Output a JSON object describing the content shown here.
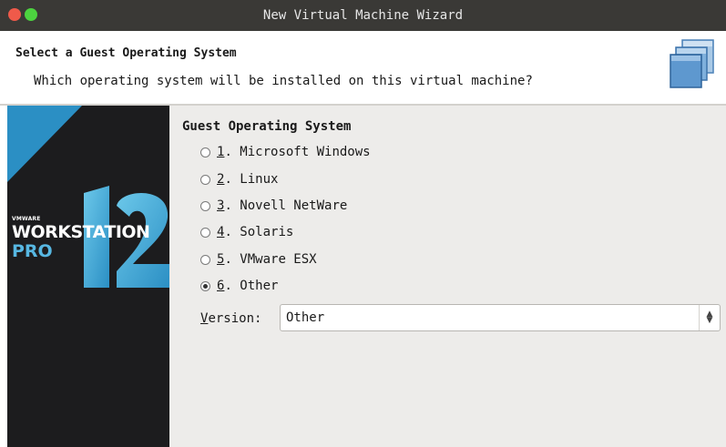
{
  "window": {
    "title": "New Virtual Machine Wizard"
  },
  "header": {
    "title": "Select a Guest Operating System",
    "subtitle": "Which operating system will be installed on this virtual machine?"
  },
  "branding": {
    "vendor": "VMWARE",
    "product": "WORKSTATION",
    "edition": "PRO",
    "version": "12"
  },
  "guest_os": {
    "section_title": "Guest Operating System",
    "selected_index": 5,
    "options": [
      {
        "mnemonic": "1",
        "label": ". Microsoft Windows"
      },
      {
        "mnemonic": "2",
        "label": ". Linux"
      },
      {
        "mnemonic": "3",
        "label": ". Novell NetWare"
      },
      {
        "mnemonic": "4",
        "label": ". Solaris"
      },
      {
        "mnemonic": "5",
        "label": ". VMware ESX"
      },
      {
        "mnemonic": "6",
        "label": ". Other"
      }
    ]
  },
  "version": {
    "label_mnemonic": "V",
    "label_rest": "ersion:",
    "value": "Other"
  },
  "colors": {
    "titlebar": "#3a3936",
    "close_button": "#ef5a4a",
    "maximize_button": "#4cd23f",
    "sidebar": "#1c1c1e",
    "accent_blue": "#2b8fc4",
    "content_bg": "#edecea"
  },
  "icons": {
    "header": "virtual-machine-icon",
    "select_arrow": "up-down-chevron-icon"
  }
}
